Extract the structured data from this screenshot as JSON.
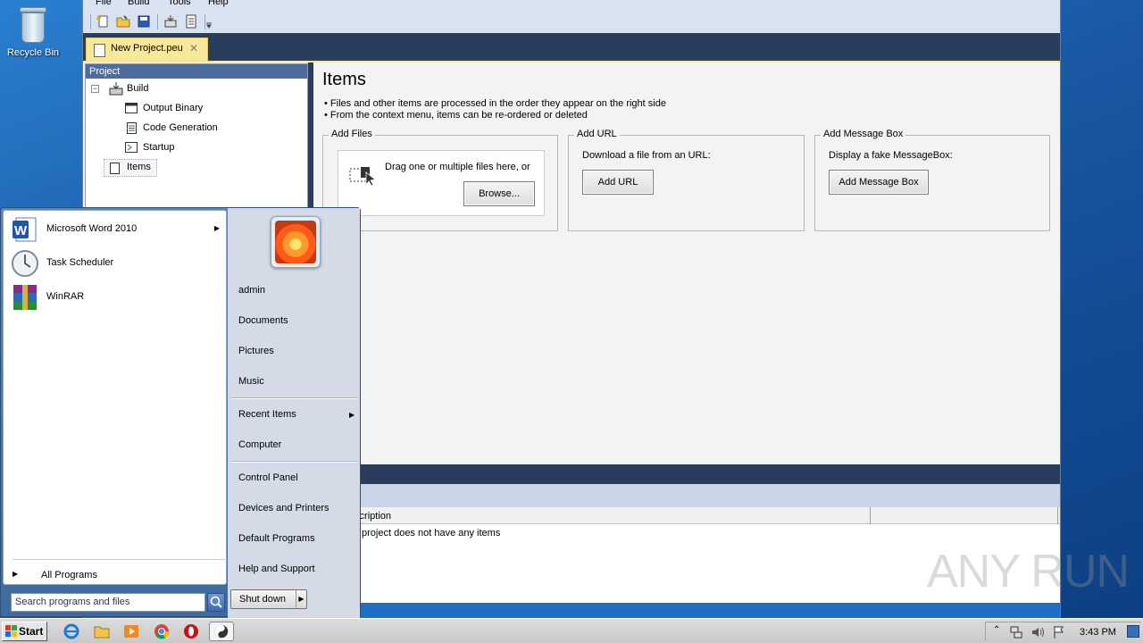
{
  "desktop": {
    "recycle_bin_label": "Recycle Bin"
  },
  "menu": {
    "file": "File",
    "build": "Build",
    "tools": "Tools",
    "help": "Help"
  },
  "tab": {
    "title": "New Project.peu",
    "close": "✕"
  },
  "project": {
    "header": "Project",
    "tree": {
      "build": "Build",
      "output_binary": "Output Binary",
      "code_generation": "Code Generation",
      "startup": "Startup",
      "items": "Items",
      "expander": "−"
    }
  },
  "content": {
    "title": "Items",
    "bullets": [
      "• Files and other items are processed in the order they appear on the right side",
      "• From the context menu, items can be re-ordered or deleted"
    ],
    "add_files": {
      "title": "Add Files",
      "drop_text": "Drag one or multiple files here, or",
      "browse": "Browse..."
    },
    "add_url": {
      "title": "Add URL",
      "text": "Download a file from an URL:",
      "button": "Add URL"
    },
    "add_message": {
      "title": "Add Message Box",
      "text": "Display a fake MessageBox:",
      "button": "Add Message Box"
    }
  },
  "list": {
    "col_description": "Description",
    "row_text": "The project does not have any items"
  },
  "startmenu": {
    "programs": [
      {
        "label": "Microsoft Word 2010",
        "icon": "word-icon",
        "has_arrow": true
      },
      {
        "label": "Task Scheduler",
        "icon": "clock-icon"
      },
      {
        "label": "WinRAR",
        "icon": "winrar-icon"
      }
    ],
    "all_programs": "All Programs",
    "search_placeholder": "Search programs and files",
    "right": {
      "user": "admin",
      "documents": "Documents",
      "pictures": "Pictures",
      "music": "Music",
      "recent": "Recent Items",
      "computer": "Computer",
      "control_panel": "Control Panel",
      "devices": "Devices and Printers",
      "default_programs": "Default Programs",
      "help": "Help and Support"
    },
    "shutdown": "Shut down"
  },
  "taskbar": {
    "start": "Start",
    "clock": "3:43 PM"
  },
  "watermark": "ANY RUN"
}
